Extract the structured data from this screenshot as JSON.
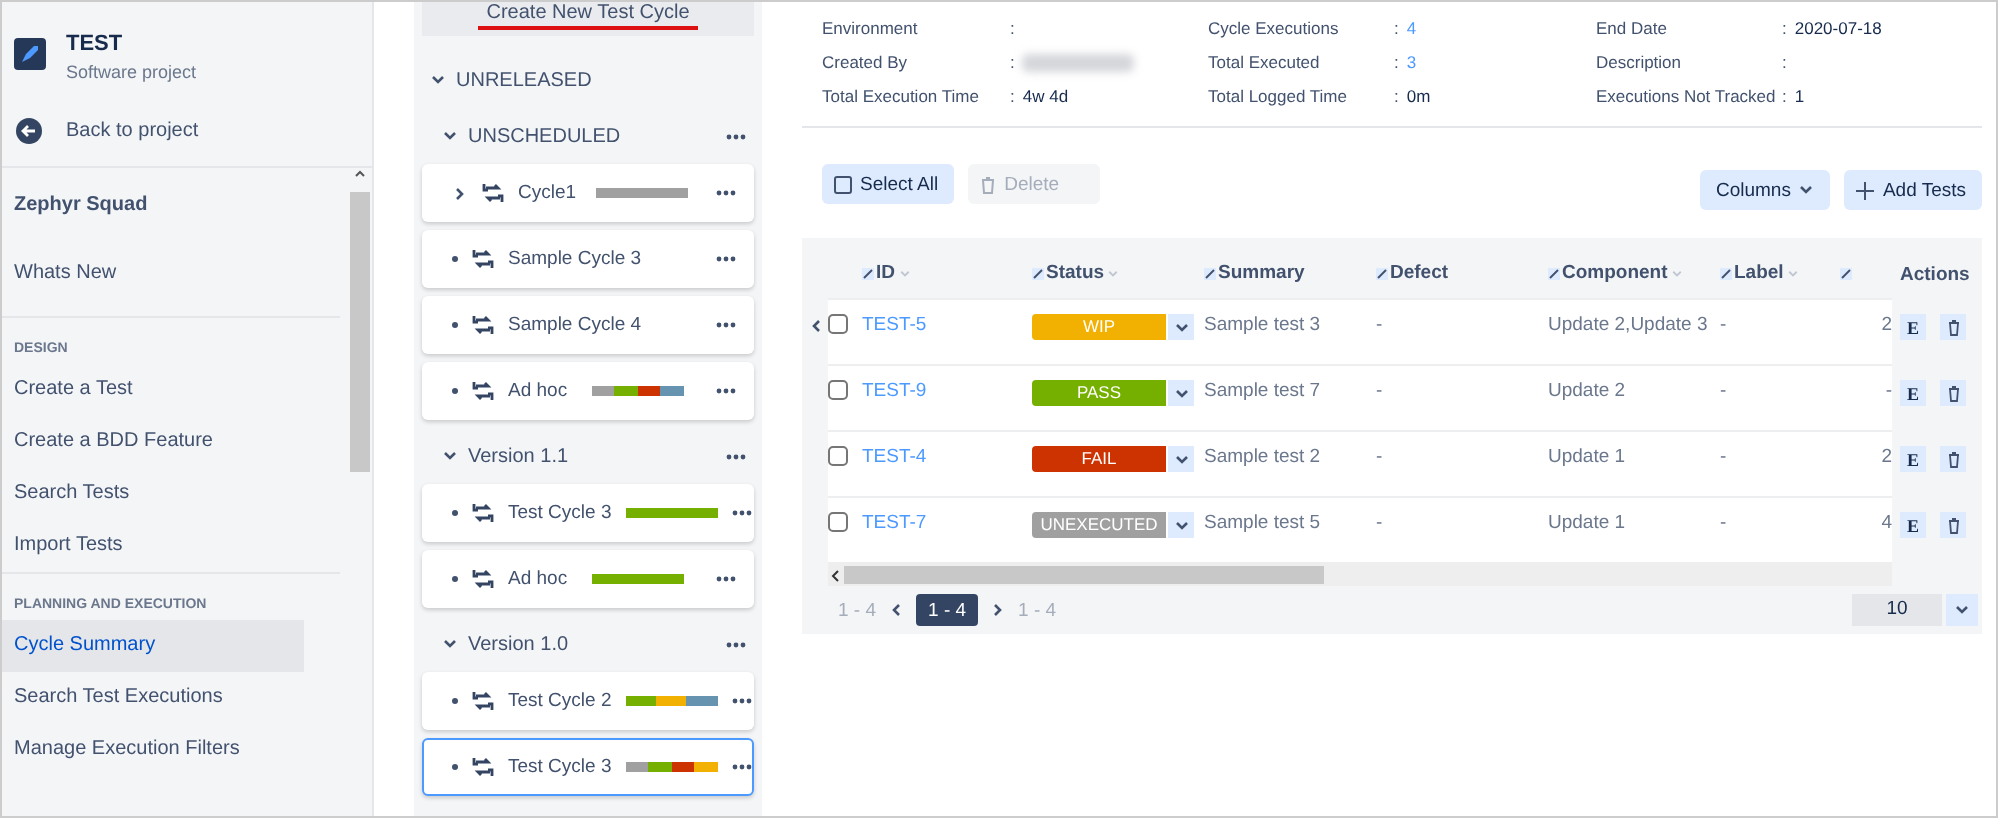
{
  "project": {
    "name": "TEST",
    "type": "Software project",
    "back": "Back to project"
  },
  "sidebar": {
    "title": "Zephyr Squad",
    "items": [
      {
        "label": "Whats New",
        "selected": false
      }
    ],
    "sections": [
      {
        "heading": "DESIGN",
        "items": [
          {
            "label": "Create a Test",
            "selected": false
          },
          {
            "label": "Create a BDD Feature",
            "selected": false
          },
          {
            "label": "Search Tests",
            "selected": false
          },
          {
            "label": "Import Tests",
            "selected": false
          }
        ]
      },
      {
        "heading": "PLANNING AND EXECUTION",
        "items": [
          {
            "label": "Cycle Summary",
            "selected": true
          },
          {
            "label": "Search Test Executions",
            "selected": false
          },
          {
            "label": "Manage Execution Filters",
            "selected": false
          }
        ]
      }
    ]
  },
  "cycles_panel": {
    "create_button": "Create New Test Cycle",
    "tree": [
      {
        "label": "UNRELEASED",
        "expanded": true,
        "children": [
          {
            "label": "UNSCHEDULED",
            "expanded": true,
            "cycles": [
              {
                "name": "Cycle1",
                "kind": "expandable",
                "selected": false,
                "segments": [
                  {
                    "color": "#a0a0a0"
                  }
                ]
              },
              {
                "name": "Sample Cycle 3",
                "kind": "leaf",
                "selected": false
              },
              {
                "name": "Sample Cycle 4",
                "kind": "leaf",
                "selected": false
              },
              {
                "name": "Ad hoc",
                "kind": "leaf",
                "selected": false,
                "segments": [
                  {
                    "color": "#a0a0a0"
                  },
                  {
                    "color": "#75b000"
                  },
                  {
                    "color": "#cc3300"
                  },
                  {
                    "color": "#6693b0"
                  }
                ]
              }
            ]
          },
          {
            "label": "Version 1.1",
            "expanded": true,
            "cycles": [
              {
                "name": "Test Cycle 3",
                "kind": "leaf",
                "selected": false,
                "segments": [
                  {
                    "color": "#75b000"
                  }
                ]
              },
              {
                "name": "Ad hoc",
                "kind": "leaf",
                "selected": false,
                "segments": [
                  {
                    "color": "#75b000"
                  }
                ]
              }
            ]
          },
          {
            "label": "Version 1.0",
            "expanded": true,
            "cycles": [
              {
                "name": "Test Cycle 2",
                "kind": "leaf",
                "selected": false,
                "segments": [
                  {
                    "color": "#75b000"
                  },
                  {
                    "color": "#f2b000"
                  },
                  {
                    "color": "#6693b0"
                  }
                ]
              },
              {
                "name": "Test Cycle 3",
                "kind": "leaf",
                "selected": true,
                "segments": [
                  {
                    "color": "#a0a0a0"
                  },
                  {
                    "color": "#75b000"
                  },
                  {
                    "color": "#cc3300"
                  },
                  {
                    "color": "#f2b000"
                  }
                ]
              }
            ]
          }
        ]
      }
    ]
  },
  "details": [
    {
      "label": "Environment",
      "colon": ":",
      "kind": "text"
    },
    {
      "label": "Cycle Executions",
      "colon": ":",
      "value": "4",
      "kind": "link"
    },
    {
      "label": "End Date",
      "colon": ":",
      "value": "2020-07-18",
      "kind": "text"
    },
    {
      "label": "Created By",
      "colon": ":",
      "kind": "redacted"
    },
    {
      "label": "Total Executed",
      "colon": ":",
      "value": "3",
      "kind": "link"
    },
    {
      "label": "Description",
      "colon": ":",
      "kind": "text"
    },
    {
      "label": "Total Execution Time",
      "colon": ":",
      "value": "4w 4d",
      "kind": "text"
    },
    {
      "label": "Total Logged Time",
      "colon": ":",
      "value": "0m",
      "kind": "text"
    },
    {
      "label": "Executions Not Tracked",
      "colon": ":",
      "value": "1",
      "kind": "text"
    }
  ],
  "toolbar": {
    "select_all": "Select All",
    "delete": {
      "label": "Delete",
      "disabled": true
    },
    "columns": "Columns",
    "add_tests": "Add Tests"
  },
  "table": {
    "columns": [
      {
        "label": "ID",
        "sortable": true
      },
      {
        "label": "Status",
        "sortable": true
      },
      {
        "label": "Summary",
        "sortable": false
      },
      {
        "label": "Defect",
        "sortable": false
      },
      {
        "label": "Component",
        "sortable": true
      },
      {
        "label": "Label",
        "sortable": true
      }
    ],
    "actions_heading": "Actions",
    "rows": [
      {
        "checked": false,
        "id": "TEST-5",
        "status": "WIP",
        "color": "#f2b000",
        "edit_key": "E",
        "summary": "Sample test 3",
        "defect": "-",
        "component": "Update 2,Update 3",
        "label": "-",
        "column_7": "2"
      },
      {
        "checked": false,
        "id": "TEST-9",
        "status": "PASS",
        "color": "#75b000",
        "edit_key": "E",
        "summary": "Sample test 7",
        "defect": "-",
        "component": "Update 2",
        "label": "-",
        "column_7": "-"
      },
      {
        "checked": false,
        "id": "TEST-4",
        "status": "FAIL",
        "color": "#cc3300",
        "edit_key": "E",
        "summary": "Sample test 2",
        "defect": "-",
        "component": "Update 1",
        "label": "-",
        "column_7": "2"
      },
      {
        "checked": false,
        "id": "TEST-7",
        "status": "UNEXECUTED",
        "color": "#a0a0a0",
        "edit_key": "E",
        "summary": "Sample test 5",
        "defect": "-",
        "component": "Update 1",
        "label": "-",
        "column_7": "4"
      }
    ]
  },
  "pagination": {
    "first": "1 - 4",
    "current": "1 - 4",
    "last": "1 - 4",
    "page_size": "10"
  }
}
